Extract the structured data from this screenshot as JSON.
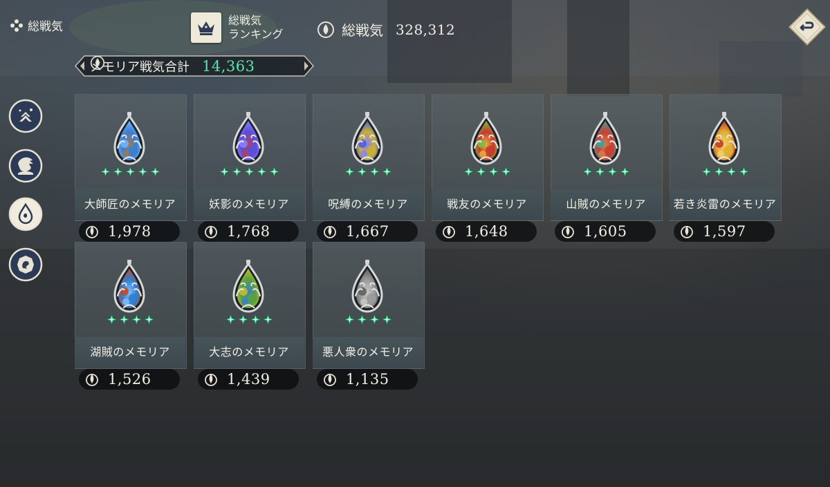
{
  "header": {
    "title": "総戦気",
    "ranking_label": "総戦気\nランキング",
    "total_power_label": "総戦気",
    "total_power_value": "328,312"
  },
  "memoria_sum": {
    "label": "メモリア戦気合計",
    "value": "14,363"
  },
  "side_nav": [
    {
      "icon": "character-ascend-icon",
      "selected": false
    },
    {
      "icon": "character-portrait-icon",
      "selected": false
    },
    {
      "icon": "memoria-drop-icon",
      "selected": true
    },
    {
      "icon": "emblem-icon",
      "selected": false
    }
  ],
  "memorias": [
    {
      "name": "大師匠のメモリア",
      "power": "1,978",
      "stars": 5,
      "colors": [
        "#3b7fd0",
        "#6fb3ff",
        "#9a7a5a"
      ]
    },
    {
      "name": "妖影のメモリア",
      "power": "1,768",
      "stars": 5,
      "colors": [
        "#5a4fd8",
        "#8b7dff",
        "#b04060"
      ]
    },
    {
      "name": "呪縛のメモリア",
      "power": "1,667",
      "stars": 4,
      "colors": [
        "#c9b030",
        "#4f5fe0",
        "#8a80ff"
      ]
    },
    {
      "name": "戦友のメモリア",
      "power": "1,648",
      "stars": 4,
      "colors": [
        "#c83a2e",
        "#7cc040",
        "#e4b040"
      ]
    },
    {
      "name": "山賊のメモリア",
      "power": "1,605",
      "stars": 4,
      "colors": [
        "#c84030",
        "#3fa0a0",
        "#d08050"
      ]
    },
    {
      "name": "若き炎雷のメモリア",
      "power": "1,597",
      "stars": 4,
      "colors": [
        "#e0b030",
        "#c83a2a",
        "#f0d070"
      ]
    },
    {
      "name": "湖賊のメモリア",
      "power": "1,526",
      "stars": 4,
      "colors": [
        "#2f7fcf",
        "#c04a2a",
        "#80c0ff"
      ]
    },
    {
      "name": "大志のメモリア",
      "power": "1,439",
      "stars": 4,
      "colors": [
        "#5aa040",
        "#c0c030",
        "#3a7fcf"
      ]
    },
    {
      "name": "悪人衆のメモリア",
      "power": "1,135",
      "stars": 4,
      "colors": [
        "#9a9a9a",
        "#606060",
        "#c8c8c8"
      ]
    }
  ]
}
